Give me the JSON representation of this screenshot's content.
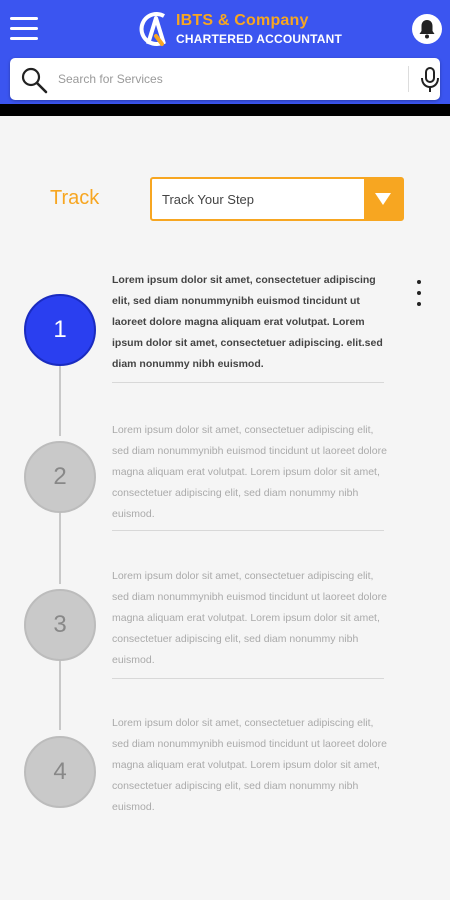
{
  "header": {
    "brand_name": "IBTS & Company",
    "brand_subtitle": "CHARTERED ACCOUNTANT",
    "icons": {
      "menu": "hamburger-icon",
      "notifications": "bell-icon",
      "logo": "ca-logo"
    }
  },
  "search": {
    "placeholder": "Search for Services",
    "icons": {
      "search": "search-icon",
      "voice": "microphone-icon"
    }
  },
  "track": {
    "label": "Track",
    "select_value": "Track Your Step",
    "dropdown_icon": "triangle-down-icon"
  },
  "steps": [
    {
      "number": "1",
      "state": "active",
      "text": "Lorem ipsum dolor sit amet, consectetuer adipiscing elit, sed diam nonummynibh euismod tincidunt ut laoreet dolore magna aliquam erat volutpat. Lorem ipsum dolor sit amet, consectetuer adipiscing. elit.sed diam nonummy nibh euismod."
    },
    {
      "number": "2",
      "state": "inactive",
      "text": "Lorem ipsum dolor sit amet, consectetuer adipiscing elit, sed diam nonummynibh euismod tincidunt ut laoreet dolore magna aliquam erat volutpat. Lorem ipsum dolor sit amet, consectetuer adipiscing elit, sed diam nonummy nibh euismod."
    },
    {
      "number": "3",
      "state": "inactive",
      "text": "Lorem ipsum dolor sit amet, consectetuer adipiscing elit, sed diam nonummynibh euismod tincidunt ut laoreet dolore magna aliquam erat volutpat. Lorem ipsum dolor sit amet, consectetuer adipiscing elit, sed diam nonummy nibh euismod."
    },
    {
      "number": "4",
      "state": "inactive",
      "text": "Lorem ipsum dolor sit amet, consectetuer adipiscing elit, sed diam nonummynibh euismod tincidunt ut laoreet dolore magna aliquam erat volutpat. Lorem ipsum dolor sit amet, consectetuer adipiscing elit, sed diam nonummy nibh euismod."
    }
  ],
  "more_menu_icon": "more-vertical-icon",
  "colors": {
    "primary": "#3b55f0",
    "accent": "#f7a621",
    "active_step": "#2a3ff0",
    "inactive_step": "#c9c9c9"
  }
}
